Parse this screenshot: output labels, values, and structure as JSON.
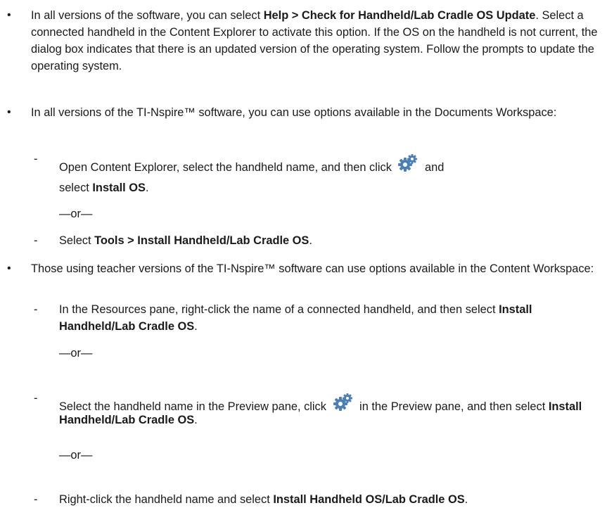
{
  "bullet_symbol": "•",
  "dash_symbol": "-",
  "or_text": "—or—",
  "b1": {
    "t1": "In all versions of the software, you can select ",
    "b1": "Help > Check for Handheld/Lab Cradle OS Update",
    "t2": ". Select a connected handheld in the Content Explorer to activate this option. If the OS on the handheld is not current, the dialog box indicates that there is an updated version of the operating system. Follow the prompts to update the operating system."
  },
  "b2": {
    "text": "In all versions of the TI-Nspire™ software, you can use options available in the Documents Workspace:",
    "s1": {
      "t1": "Open Content Explorer, select the handheld name, and then click ",
      "t2": " and select ",
      "b1": "Install OS",
      "t3": "."
    },
    "s2": {
      "t1": "Select ",
      "b1": "Tools > Install Handheld/Lab Cradle OS",
      "t2": "."
    }
  },
  "b3": {
    "text": "Those using teacher versions of the TI-Nspire™ software can use options available in the Content Workspace:",
    "s1": {
      "t1": "In the Resources pane, right-click the name of a connected handheld, and then select ",
      "b1": "Install Handheld/Lab Cradle OS",
      "t2": "."
    },
    "s2": {
      "t1": "Select the handheld name in the Preview pane, click ",
      "t2": " in the Preview pane, and then select ",
      "b1": "Install Handheld/Lab Cradle OS",
      "t3": "."
    },
    "s3": {
      "t1": "Right-click the handheld name and select ",
      "b1": "Install Handheld OS/Lab Cradle OS",
      "t2": "."
    }
  },
  "icons": {
    "gear": "gear-icon"
  },
  "colors": {
    "text": "#1a1a1a",
    "gear_blue": "#4a7fb8"
  }
}
